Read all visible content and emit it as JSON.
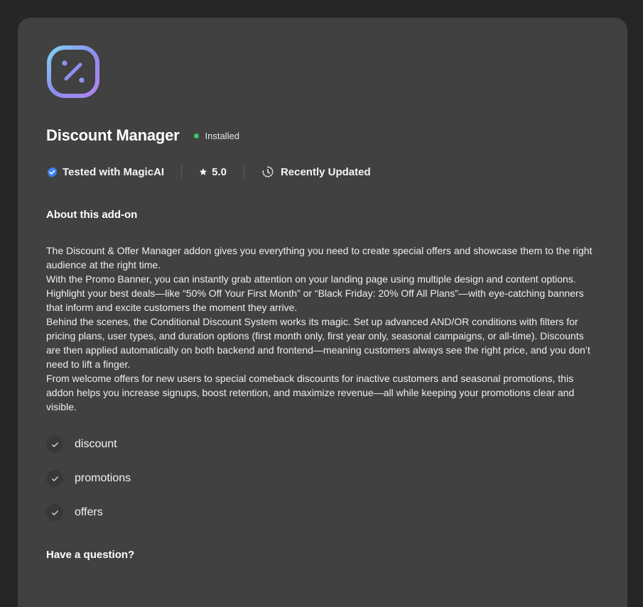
{
  "addon": {
    "name": "Discount Manager",
    "status": "Installed",
    "logo_icon": "percent-icon",
    "status_color": "#36c76a"
  },
  "meta": {
    "tested": "Tested with MagicAI",
    "rating": "5.0",
    "updated": "Recently Updated",
    "verified_color": "#3b82f6"
  },
  "about": {
    "title": "About this add-on",
    "paragraphs": [
      "The Discount & Offer Manager addon gives you everything you need to create special offers and showcase them to the right audience at the right time.",
      "With the Promo Banner, you can instantly grab attention on your landing page using multiple design and content options. Highlight your best deals—like “50% Off Your First Month” or “Black Friday: 20% Off All Plans”—with eye-catching banners that inform and excite customers the moment they arrive.",
      "Behind the scenes, the Conditional Discount System works its magic. Set up advanced AND/OR conditions with filters for pricing plans, user types, and duration options (first month only, first year only, seasonal campaigns, or all-time). Discounts are then applied automatically on both backend and frontend—meaning customers always see the right price, and you don’t need to lift a finger.",
      "From welcome offers for new users to special comeback discounts for inactive customers and seasonal promotions, this addon helps you increase signups, boost retention, and maximize revenue—all while keeping your promotions clear and visible."
    ]
  },
  "tags": [
    "discount",
    "promotions",
    "offers"
  ],
  "question": {
    "title": "Have a question?"
  }
}
